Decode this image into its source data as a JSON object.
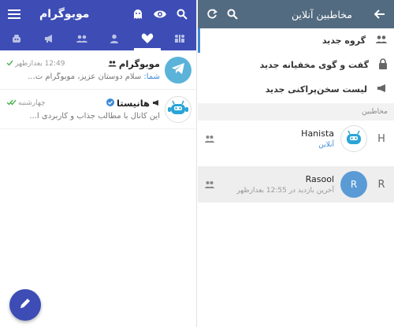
{
  "left": {
    "title": "موبوگرام",
    "tabs": [
      {
        "name": "tab-robots",
        "icon": "robot-icon"
      },
      {
        "name": "tab-channels",
        "icon": "megaphone-icon"
      },
      {
        "name": "tab-groups",
        "icon": "group-icon"
      },
      {
        "name": "tab-contacts",
        "icon": "person-icon"
      },
      {
        "name": "tab-favorites",
        "icon": "heart-icon"
      },
      {
        "name": "tab-all",
        "icon": "all-icon"
      }
    ],
    "chats": [
      {
        "name": "موبوگرام",
        "time": "12:49 بعدازظهر",
        "sender": "شما:",
        "preview": " سلام دوستان عزیز، موبوگرام ت..."
      },
      {
        "name": "هانیستا",
        "time": "چهارشنبه",
        "preview": "این کانال با مطالب جذاب و کاربردی آ..."
      }
    ]
  },
  "right": {
    "title": "مخاطبین آنلاین",
    "options": [
      "گروه جدید",
      "گفت و گوی مخفیانه جدید",
      "لیست سخن‌پراکنی جدید"
    ],
    "section": "مخاطبین",
    "contacts": [
      {
        "letter": "H",
        "name": "Hanista",
        "status": "آنلاین",
        "avatar": "android"
      },
      {
        "letter": "R",
        "name": "Rasool",
        "status": "آخرین بازدید در 12:55 بعدازظهر",
        "avatar": "R"
      }
    ]
  },
  "colors": {
    "accent": "#3d4db5",
    "header_right": "#536b80",
    "link": "#3d8bd6",
    "check": "#4caf50"
  }
}
